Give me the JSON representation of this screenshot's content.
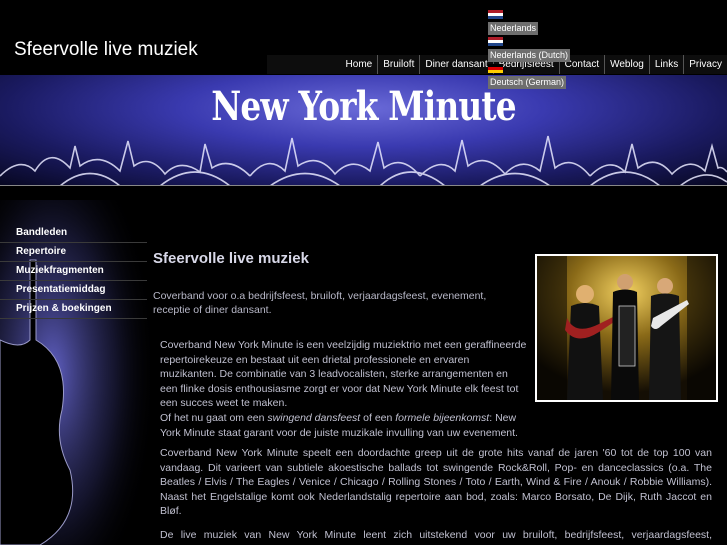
{
  "header": {
    "site_title": "Sfeervolle live muziek"
  },
  "languages": [
    {
      "label": "Nederlands",
      "flag": [
        "#ae1c28",
        "#ffffff",
        "#21468b"
      ]
    },
    {
      "label": "Nederlands (Dutch)",
      "flag": [
        "#ae1c28",
        "#ffffff",
        "#21468b"
      ]
    },
    {
      "label": "Deutsch (German)",
      "flag": [
        "#000000",
        "#dd0000",
        "#ffce00"
      ]
    }
  ],
  "top_nav": [
    "Home",
    "Bruiloft",
    "Diner dansant",
    "Bedrijfsfeest",
    "Contact",
    "Weblog",
    "Links",
    "Privacy"
  ],
  "banner": {
    "title": "New York Minute"
  },
  "side_nav": [
    "Bandleden",
    "Repertoire",
    "Muziekfragmenten",
    "Presentatiemiddag",
    "Prijzen & boekingen"
  ],
  "main": {
    "title": "Sfeervolle live muziek",
    "intro": "Coverband voor o.a bedrijfsfeest, bruiloft, verjaardagsfeest, evenement, receptie of diner dansant.",
    "para1_a": "Coverband New York Minute is een veelzijdig muziektrio met een geraffineerde repertoirekeuze en bestaat uit een drietal professionele en ervaren muzikanten. De combinatie van 3 leadvocalisten, sterke arrangementen en een flinke dosis enthousiasme zorgt er voor dat New York Minute elk feest tot een succes weet te maken.",
    "para1_b": "Of het nu gaat om een ",
    "para1_em1": "swingend dansfeest",
    "para1_c": " of een ",
    "para1_em2": "formele bijeenkomst",
    "para1_d": ": New York Minute staat garant voor de juiste muzikale invulling van uw evenement.",
    "para2": "Coverband New York Minute speelt een doordachte greep uit de grote hits vanaf de jaren '60 tot de top 100 van vandaag. Dit varieert van subtiele akoestische ballads tot swingende Rock&Roll, Pop- en danceclassics (o.a. The Beatles / Elvis / The Eagles / Venice / Chicago / Rolling Stones / Toto / Earth, Wind & Fire / Anouk / Robbie Williams). Naast het Engelstalige komt ook Nederlandstalig repertoire aan bod, zoals: Marco Borsato, De Dijk, Ruth Jaccot en Bløf.",
    "para3": "De live muziek van New York Minute leent zich uitstekend voor uw bruiloft, bedrijfsfeest, verjaardagsfeest,"
  }
}
